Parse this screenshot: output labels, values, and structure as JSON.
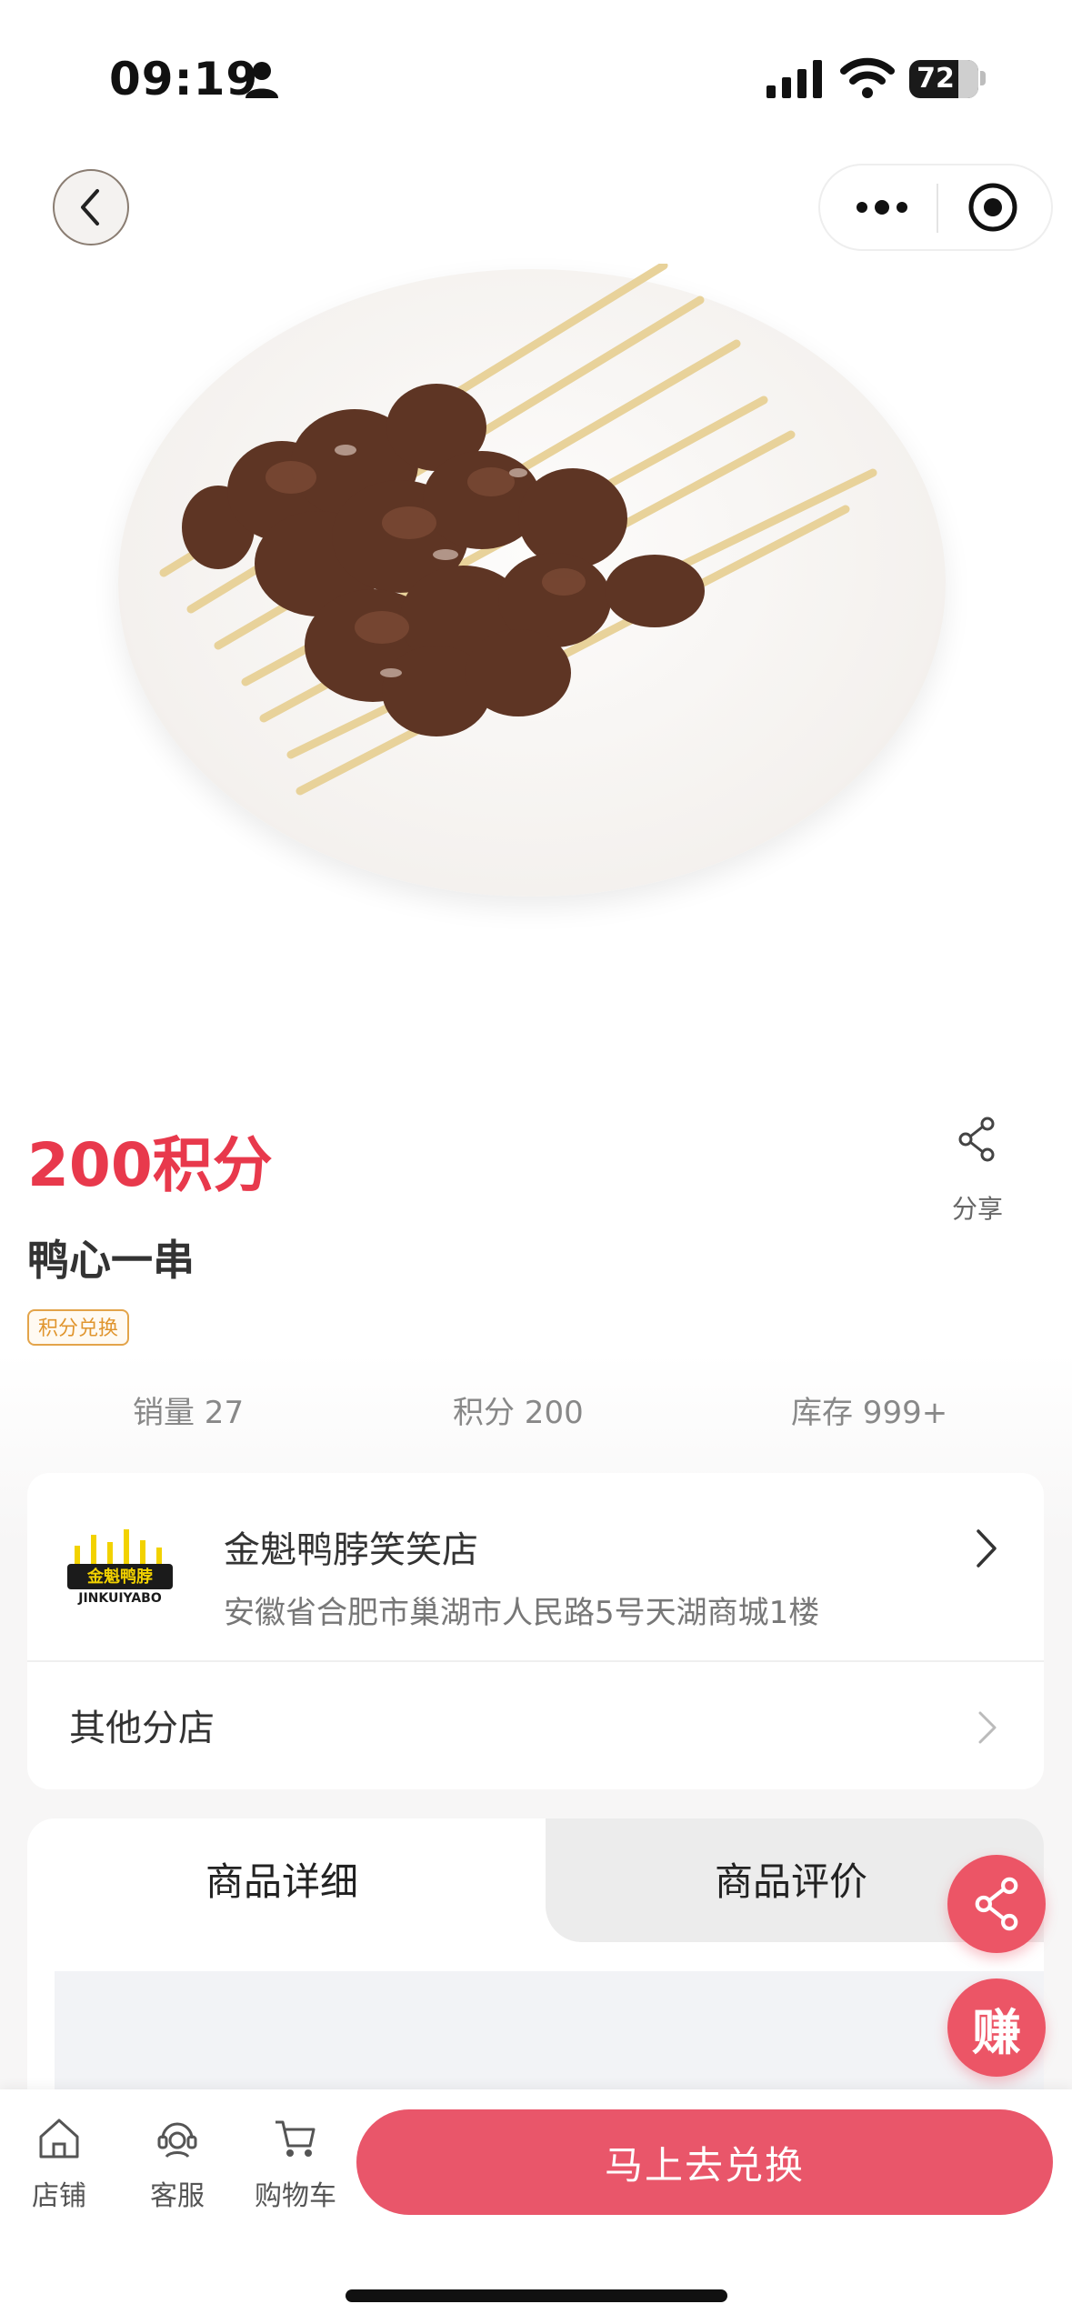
{
  "status_bar": {
    "time": "09:19",
    "battery": "72"
  },
  "product": {
    "price": "200积分",
    "name": "鸭心一串",
    "tag": "积分兑换",
    "share_label": "分享",
    "stats": [
      "销量 27",
      "积分 200",
      "库存 999+"
    ]
  },
  "shop": {
    "name": "金魁鸭脖笑笑店",
    "address": "安徽省合肥市巢湖市人民路5号天湖商城1楼",
    "logo_text": "金魁鸭脖",
    "logo_subtext": "JINKUIYABO",
    "branches_label": "其他分店"
  },
  "tabs": {
    "active": "商品详细",
    "inactive": "商品评价"
  },
  "fab": {
    "earn_label": "赚"
  },
  "bottom_nav": {
    "items": [
      {
        "label": "店铺",
        "icon": "store-icon"
      },
      {
        "label": "客服",
        "icon": "customer-service-icon"
      },
      {
        "label": "购物车",
        "icon": "cart-icon"
      }
    ],
    "cta_label": "马上去兑换"
  },
  "colors": {
    "price_red": "#e8394c",
    "cta_pink": "#e9566a",
    "tag_orange": "#e3a44a"
  }
}
